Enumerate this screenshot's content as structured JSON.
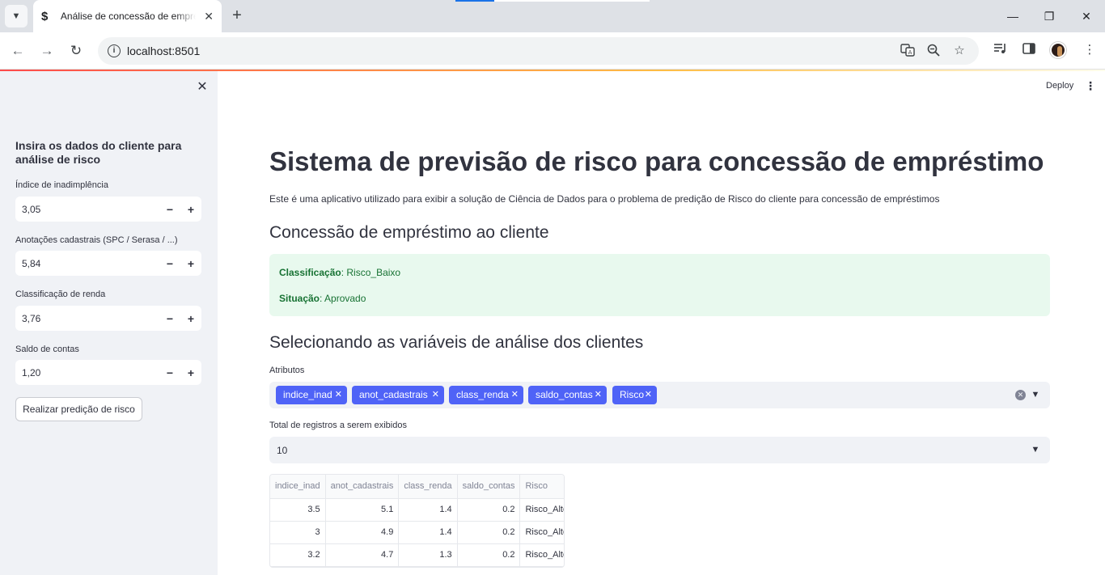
{
  "browser": {
    "tab_title": "Análise de concessão de empréstimo",
    "tab_favicon": "$",
    "url": "localhost:8501",
    "icons": {
      "tab_list": "chevron-down-icon",
      "new_tab": "plus-icon",
      "back": "arrow-left-icon",
      "forward": "arrow-right-icon",
      "reload": "reload-icon",
      "translate": "translate-icon",
      "zoom": "zoom-icon",
      "bookmark": "star-icon",
      "media": "media-icon",
      "side_panel": "side-panel-icon",
      "menu": "kebab-icon"
    }
  },
  "app": {
    "deploy_label": "Deploy",
    "accent_color": "#4f63f7",
    "success_color": "#177233"
  },
  "sidebar": {
    "header": "Insira os dados do cliente para análise de risco",
    "fields": [
      {
        "label": "Índice de inadimplência",
        "value": "3,05"
      },
      {
        "label": "Anotações cadastrais (SPC / Serasa / ...)",
        "value": "5,84"
      },
      {
        "label": "Classificação de renda",
        "value": "3,76"
      },
      {
        "label": "Saldo de contas",
        "value": "1,20"
      }
    ],
    "decrement_symbol": "−",
    "increment_symbol": "+",
    "button_label": "Realizar predição de risco"
  },
  "main": {
    "title": "Sistema de previsão de risco para concessão de empréstimo",
    "description": "Este é uma aplicativo utilizado para exibir a solução de Ciência de Dados para o problema de predição de Risco do cliente para concessão de empréstimos",
    "section1_title": "Concessão de empréstimo ao cliente",
    "result": {
      "classificacao_label": "Classificação",
      "classificacao_value": ": Risco_Baixo",
      "situacao_label": "Situação",
      "situacao_value": ": Aprovado"
    },
    "section2_title": "Selecionando as variáveis de análise dos clientes",
    "attributes_label": "Atributos",
    "attributes": [
      "indice_inad",
      "anot_cadastrais",
      "class_renda",
      "saldo_contas",
      "Risco"
    ],
    "records_label": "Total de registros a serem exibidos",
    "records_value": "10",
    "table": {
      "columns": [
        "indice_inad",
        "anot_cadastrais",
        "class_renda",
        "saldo_contas",
        "Risco"
      ],
      "rows": [
        [
          "3.5",
          "5.1",
          "1.4",
          "0.2",
          "Risco_Alto"
        ],
        [
          "3",
          "4.9",
          "1.4",
          "0.2",
          "Risco_Alto"
        ],
        [
          "3.2",
          "4.7",
          "1.3",
          "0.2",
          "Risco_Alto"
        ]
      ]
    }
  }
}
